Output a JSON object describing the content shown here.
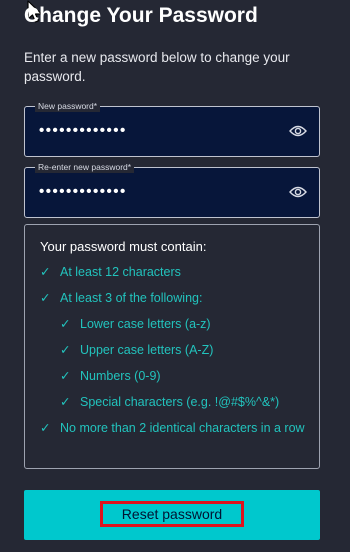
{
  "title": "Change Your Password",
  "intro": "Enter a new password below to change your password.",
  "fields": {
    "new_password": {
      "label": "New password*",
      "value": "•••••••••••••",
      "toggle_icon": "eye-icon"
    },
    "reenter_password": {
      "label": "Re-enter new password*",
      "value": "•••••••••••••",
      "toggle_icon": "eye-icon"
    }
  },
  "requirements": {
    "title": "Your password must contain:",
    "check_glyph": "✓",
    "items": [
      {
        "text": "At least 12 characters"
      },
      {
        "text": "At least 3 of the following:"
      },
      {
        "text": "Lower case letters (a-z)"
      },
      {
        "text": "Upper case letters (A-Z)"
      },
      {
        "text": "Numbers (0-9)"
      },
      {
        "text": "Special characters (e.g. !@#$%^&*)"
      },
      {
        "text": "No more than 2 identical characters in a row"
      }
    ]
  },
  "reset_button": {
    "label": "Reset password"
  },
  "colors": {
    "background": "#252834",
    "field_background": "#07163a",
    "accent": "#00c8cd",
    "requirement_text": "#22c3bd",
    "highlight_box": "#e0131d"
  }
}
